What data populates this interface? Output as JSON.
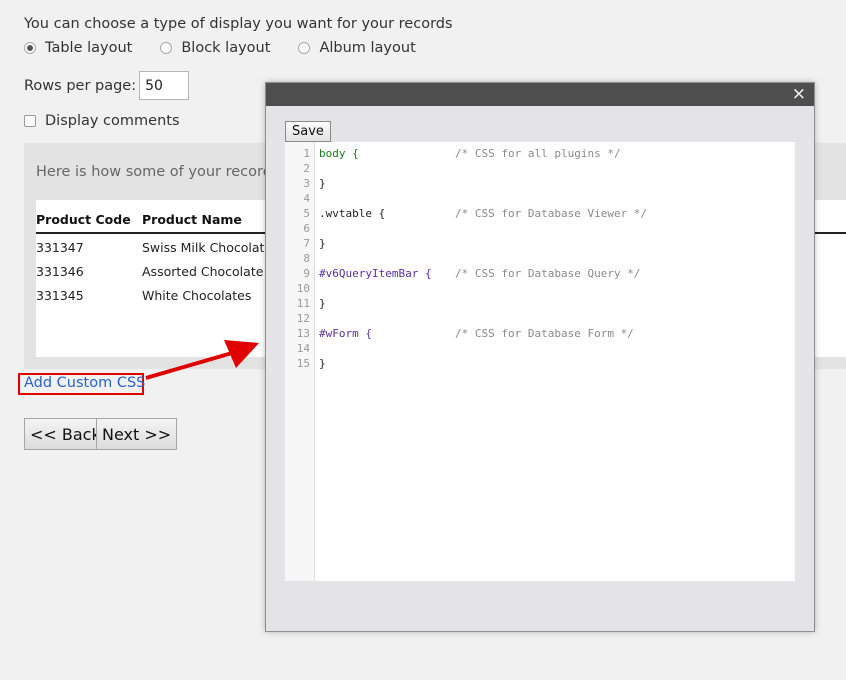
{
  "intro_text": "You can choose a type of display you want for your records",
  "layout_options": [
    {
      "label": "Table layout",
      "checked": true
    },
    {
      "label": "Block layout",
      "checked": false
    },
    {
      "label": "Album layout",
      "checked": false
    }
  ],
  "rows_per_page": {
    "label": "Rows per page:",
    "value": "50"
  },
  "display_comments_label": "Display comments",
  "preview": {
    "caption": "Here is how some of your records w",
    "headers": [
      "Product Code",
      "Product Name"
    ],
    "rows": [
      [
        "331347",
        "Swiss Milk Chocolate"
      ],
      [
        "331346",
        "Assorted Chocolate Bo"
      ],
      [
        "331345",
        "White Chocolates"
      ]
    ]
  },
  "add_custom_css": "Add Custom CSS",
  "nav": {
    "back": "<< Back",
    "next": "Next >>"
  },
  "modal": {
    "close": "×",
    "save": "Save",
    "line_numbers": [
      "1",
      "2",
      "3",
      "4",
      "5",
      "6",
      "7",
      "8",
      "9",
      "10",
      "11",
      "12",
      "13",
      "14",
      "15"
    ],
    "code": [
      {
        "selector": "body {",
        "kind": "tag",
        "comment": "/* CSS for all plugins */"
      },
      {
        "text": ""
      },
      {
        "text": "}"
      },
      {
        "text": ""
      },
      {
        "selector": ".wvtable {",
        "kind": "class",
        "comment": "/* CSS for Database Viewer */"
      },
      {
        "text": ""
      },
      {
        "text": "}"
      },
      {
        "text": ""
      },
      {
        "selector": "#v6QueryItemBar {",
        "kind": "id",
        "comment": "/* CSS for Database Query */"
      },
      {
        "text": ""
      },
      {
        "text": "}"
      },
      {
        "text": ""
      },
      {
        "selector": "#wForm {",
        "kind": "id",
        "comment": "/* CSS for Database Form */"
      },
      {
        "text": ""
      },
      {
        "text": "}"
      }
    ]
  },
  "colors": {
    "annotation_red": "#e00000",
    "link_blue": "#2a62c9",
    "modal_titlebar": "#4f4f4f"
  }
}
